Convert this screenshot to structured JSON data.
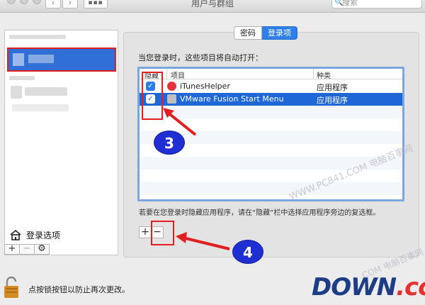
{
  "window": {
    "title": "用户与群组",
    "search_placeholder": "搜索"
  },
  "nav": {
    "back": "‹",
    "forward": "›",
    "grid": "▪▪▪"
  },
  "sidebar": {
    "login_items_label": "登录选项",
    "add_label": "+",
    "remove_label": "−",
    "gear_label": "⚙"
  },
  "tabs": [
    {
      "label": "密码",
      "active": false
    },
    {
      "label": "登录项",
      "active": true
    }
  ],
  "login_panel": {
    "intro": "当您登录时，这些项目将自动打开：",
    "columns": [
      "隐藏",
      "项目",
      "种类"
    ],
    "rows": [
      {
        "hide_checked": true,
        "name": "iTunesHelper",
        "kind": "应用程序",
        "icon": "itunes-icon",
        "selected": false
      },
      {
        "hide_checked": true,
        "name": "VMware Fusion Start Menu",
        "kind": "应用程序",
        "icon": "vmware-icon",
        "selected": true
      }
    ],
    "hint": "若要在您登录时隐藏应用程序，请在“隐藏”栏中选择应用程序旁边的复选框。",
    "add_label": "+",
    "remove_label": "−"
  },
  "annotations": {
    "step3": "3",
    "step4": "4",
    "accent": "#e02020",
    "badge_color": "#1f2fd4"
  },
  "footer": {
    "lock_text": "点按锁按钮以防止再次更改。"
  },
  "watermarks": {
    "mid": "WWW.PC841.COM 电脑百事网",
    "low": ".COM 电脑百事网",
    "brand_main": "DOWN",
    "brand_tld": ".cc"
  }
}
